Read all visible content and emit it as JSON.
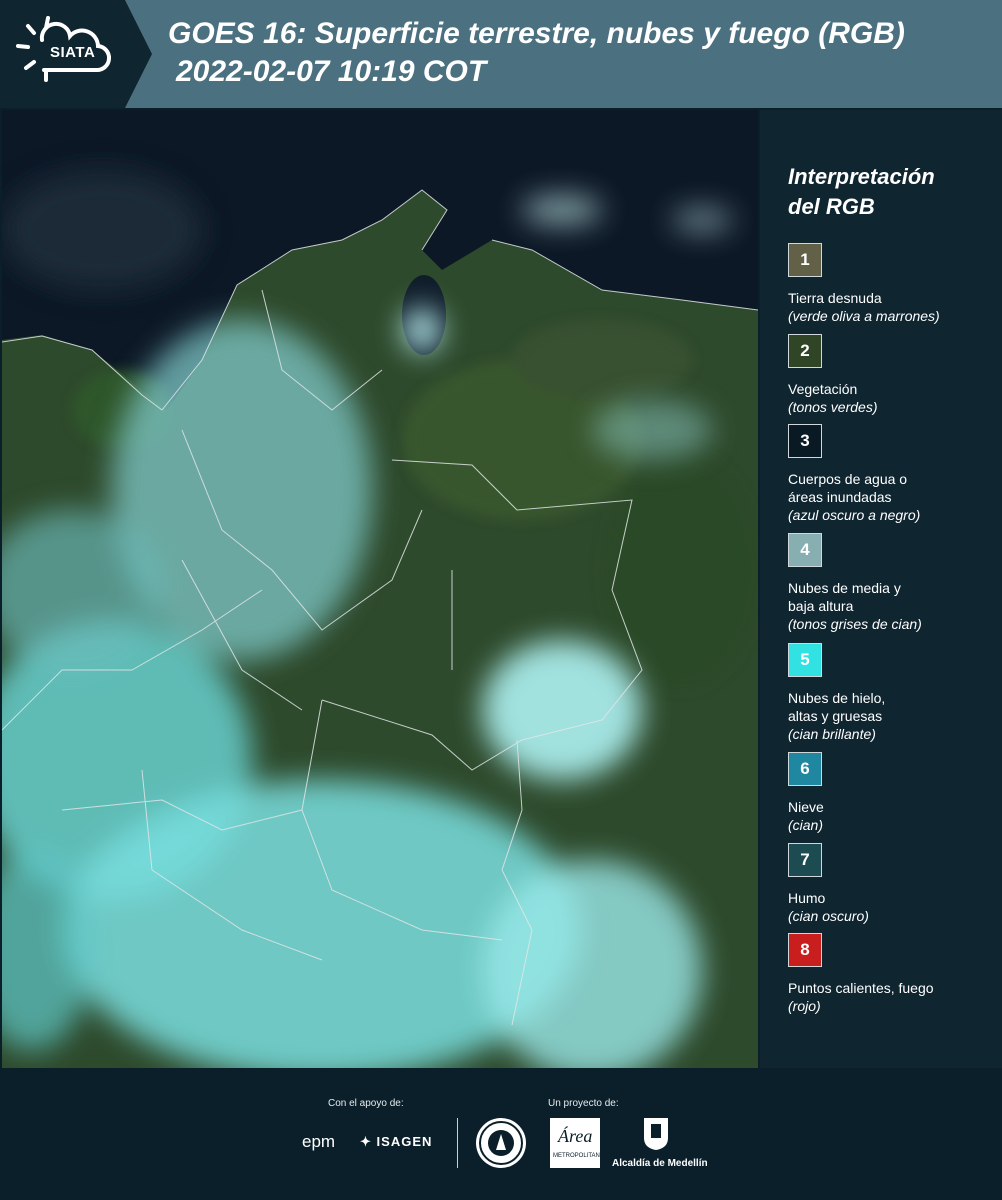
{
  "header": {
    "logo_text": "SIATA",
    "title": "GOES 16: Superficie terrestre, nubes y fuego (RGB)",
    "subtitle": "2022-02-07 10:19 COT"
  },
  "legend": {
    "title_line1": "Interpretación",
    "title_line2": "del RGB",
    "items": [
      {
        "number": "1",
        "color": "#626148",
        "label": "Tierra desnuda",
        "label2": "",
        "desc": "(verde oliva a marrones)"
      },
      {
        "number": "2",
        "color": "#2f4526",
        "label": "Vegetación",
        "label2": "",
        "desc": "(tonos verdes)"
      },
      {
        "number": "3",
        "color": "#0a1a24",
        "label": "Cuerpos de agua o",
        "label2": "áreas inundadas",
        "desc": "(azul oscuro a negro)"
      },
      {
        "number": "4",
        "color": "#87aeb0",
        "label": "Nubes de media y",
        "label2": "baja altura",
        "desc": "(tonos grises de cian)"
      },
      {
        "number": "5",
        "color": "#32e2e2",
        "label": "Nubes de hielo,",
        "label2": "altas y gruesas",
        "desc": "(cian brillante)"
      },
      {
        "number": "6",
        "color": "#1f87a0",
        "label": "Nieve",
        "label2": "",
        "desc": "(cian)"
      },
      {
        "number": "7",
        "color": "#1c4c52",
        "label": "Humo",
        "label2": "",
        "desc": "(cian oscuro)"
      },
      {
        "number": "8",
        "color": "#c81e1e",
        "label": "Puntos calientes, fuego",
        "label2": "",
        "desc": "(rojo)"
      }
    ]
  },
  "footer": {
    "support_label": "Con el apoyo de:",
    "project_label": "Un proyecto de:",
    "sponsor_epm": "epm",
    "sponsor_isagen": "ISAGEN",
    "sponsor_area": "Área",
    "sponsor_area_sub": "METROPOLITANA",
    "sponsor_alcaldia": "Alcaldía de Medellín"
  }
}
